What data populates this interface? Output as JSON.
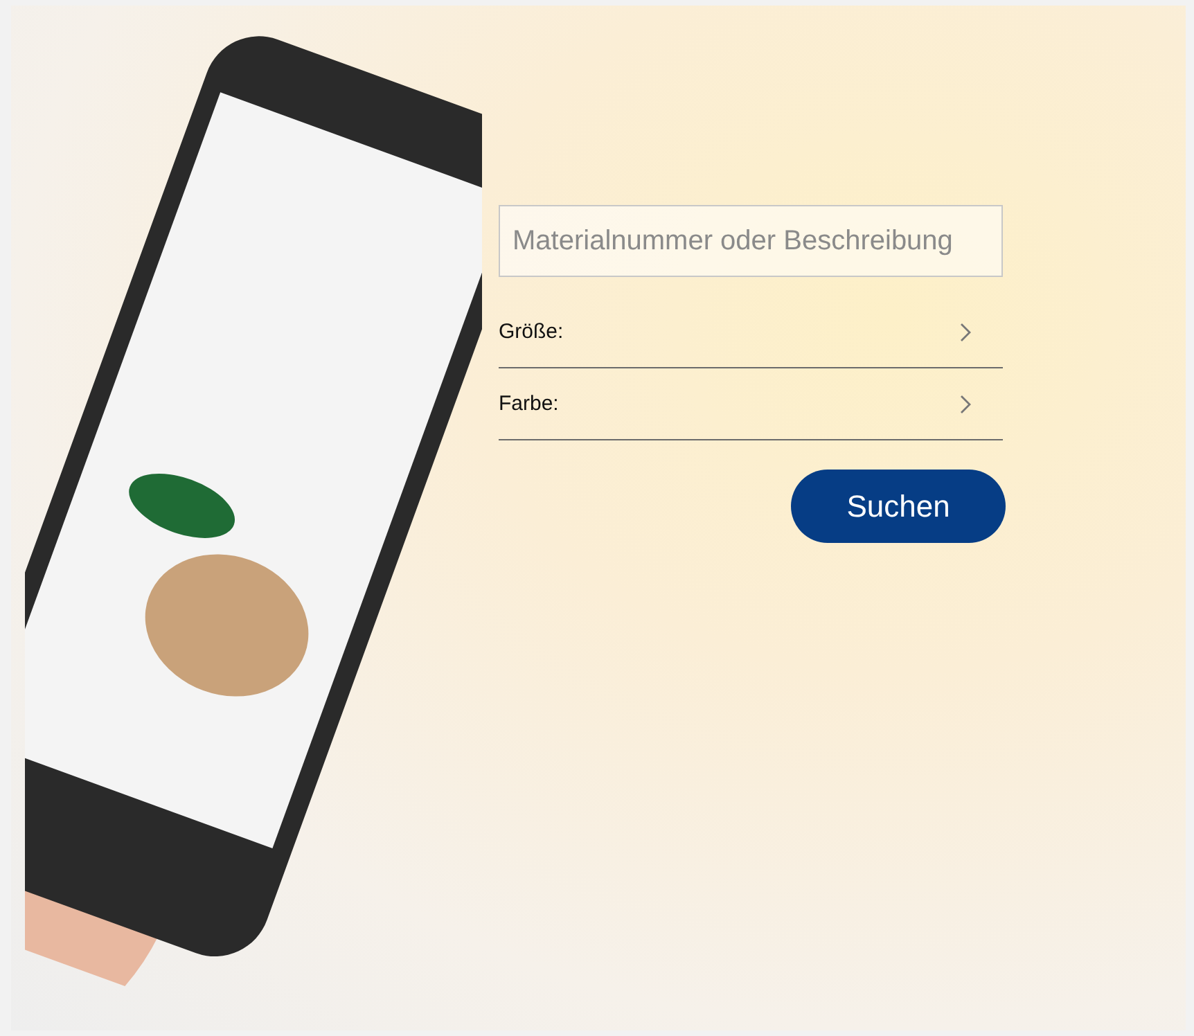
{
  "search": {
    "placeholder": "Materialnummer oder Beschreibung"
  },
  "filters": [
    {
      "label": "Größe:"
    },
    {
      "label": "Farbe:"
    }
  ],
  "button": {
    "label": "Suchen"
  }
}
